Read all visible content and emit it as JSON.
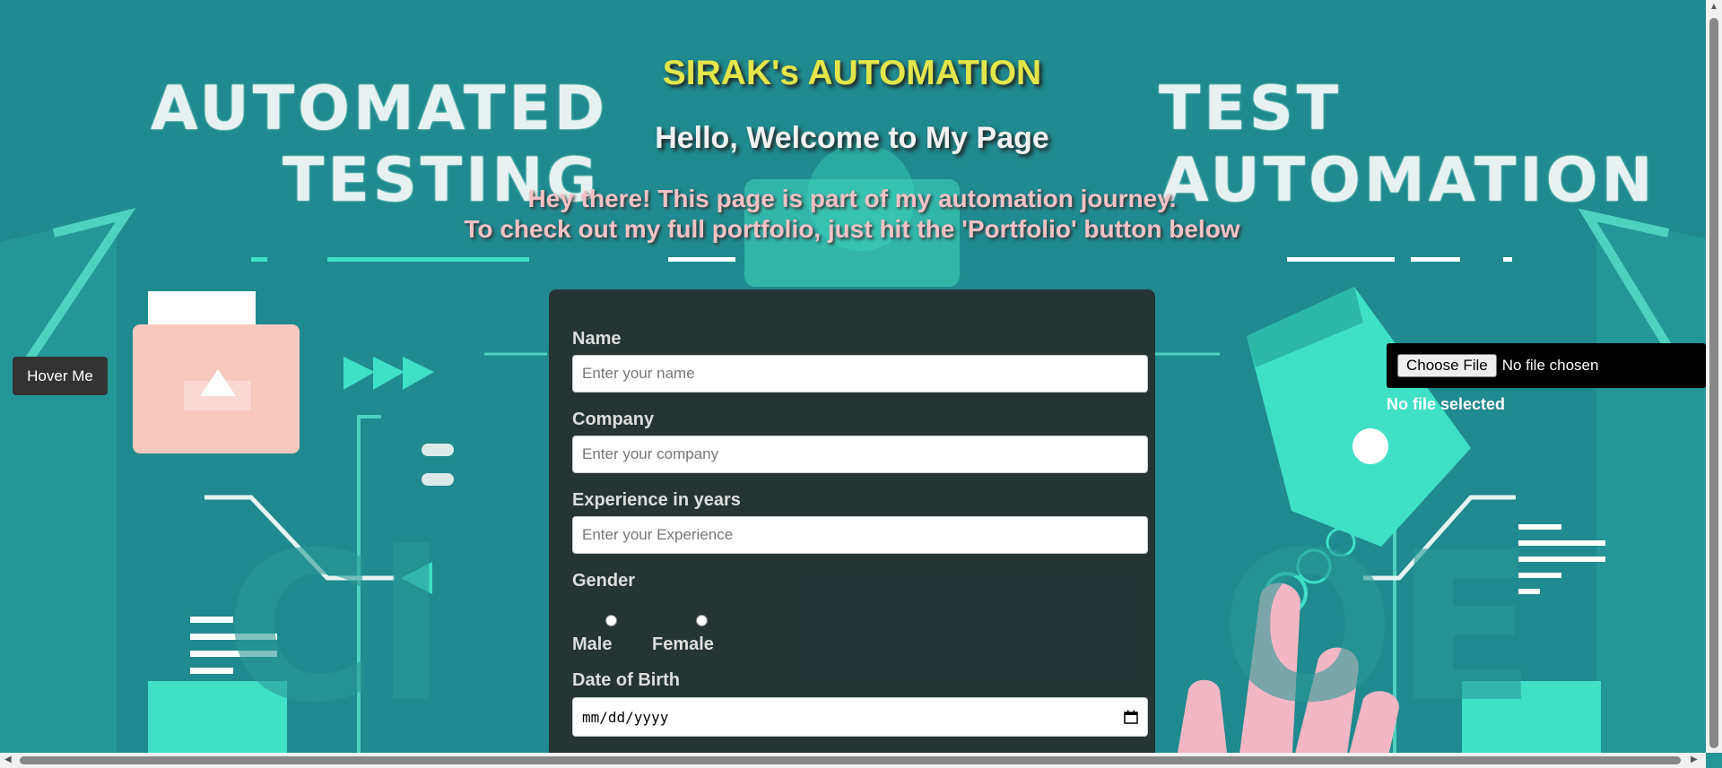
{
  "background": {
    "words_left": [
      "AUTOMATED",
      "TESTING"
    ],
    "words_right": [
      "TEST",
      "AUTOMATION"
    ]
  },
  "header": {
    "title": "SIRAK's AUTOMATION",
    "welcome": "Hello, Welcome to My Page",
    "intro_line1": "Hey there! This page is part of my automation journey.",
    "intro_line2": "To check out my full portfolio, just hit the 'Portfolio' button below"
  },
  "hover_button": {
    "label": "Hover Me"
  },
  "file_upload": {
    "button_label": "Choose File",
    "status": "No file chosen",
    "selected_text": "No file selected"
  },
  "form": {
    "name": {
      "label": "Name",
      "placeholder": "Enter your name"
    },
    "company": {
      "label": "Company",
      "placeholder": "Enter your company"
    },
    "experience": {
      "label": "Experience in years",
      "placeholder": "Enter your Experience"
    },
    "gender": {
      "label": "Gender",
      "options": [
        "Male",
        "Female"
      ]
    },
    "dob": {
      "label": "Date of Birth",
      "placeholder": "mm/dd/yyyy"
    }
  },
  "colors": {
    "background": "#1f8a8f",
    "title": "#e3e54a",
    "intro": "#f4c2c6",
    "panel": "#282828"
  }
}
